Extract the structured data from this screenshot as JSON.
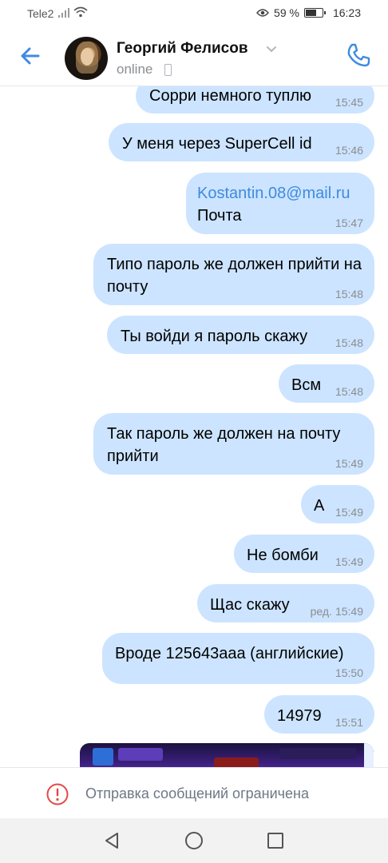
{
  "status_bar": {
    "carrier": "Tele2",
    "battery": "59 %",
    "time": "16:23"
  },
  "header": {
    "name": "Георгий Фелисов",
    "status": "online",
    "icons": {
      "back": "back-arrow-icon",
      "call": "phone-icon",
      "chevron": "chevron-down-icon"
    }
  },
  "messages": [
    {
      "text": "Сорри немного туплю",
      "time": "15:45"
    },
    {
      "text": "У меня через SuperCell id",
      "time": "15:46"
    },
    {
      "email": "Kostantin.08@mail.ru",
      "text": "Почта",
      "time": "15:47"
    },
    {
      "text": "Типо пароль же должен прийти на почту",
      "time": "15:48"
    },
    {
      "text": "Ты войди я пароль скажу",
      "time": "15:48"
    },
    {
      "text": "Всм",
      "time": "15:48"
    },
    {
      "text": "Так пароль же должен на почту прийти",
      "time": "15:49"
    },
    {
      "text": "А",
      "time": "15:49"
    },
    {
      "text": "Не бомби",
      "time": "15:49"
    },
    {
      "text": "Щас скажу",
      "time": "15:49",
      "edited": "ред."
    },
    {
      "text": "Вроде 125643ааа (английские)",
      "time": "15:50"
    },
    {
      "text": "14979",
      "time": "15:51"
    }
  ],
  "restricted": {
    "text": "Отправка сообщений ограничена"
  },
  "colors": {
    "accent": "#3f8ae0",
    "bubble": "#cce4ff",
    "warning": "#e64646"
  }
}
